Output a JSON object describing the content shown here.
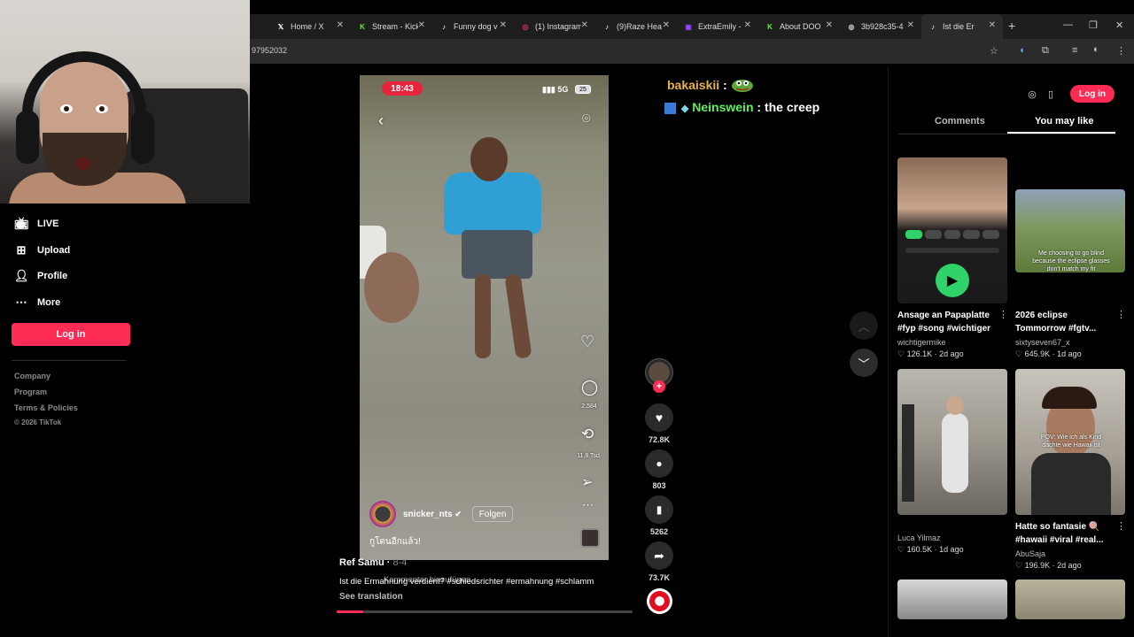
{
  "browser": {
    "tabs": [
      {
        "label": "Home / X",
        "icon": "x-logo-icon",
        "color": "#ffffff"
      },
      {
        "label": "Stream - Kick",
        "icon": "kick-logo-icon",
        "color": "#53fc18"
      },
      {
        "label": "Funny dog v",
        "icon": "tiktok-logo-icon",
        "color": "#ffffff"
      },
      {
        "label": "(1) Instagram",
        "icon": "instagram-logo-icon",
        "color": "#e1306c"
      },
      {
        "label": "(9)Raze Hea",
        "icon": "tiktok-logo-icon",
        "color": "#ffffff"
      },
      {
        "label": "ExtraEmily -",
        "icon": "twitch-logo-icon",
        "color": "#9146ff"
      },
      {
        "label": "About DOO",
        "icon": "kick-logo-icon",
        "color": "#53fc18"
      },
      {
        "label": "3b928c35-4",
        "icon": "globe-icon",
        "color": "#bbbbbb"
      },
      {
        "label": "Ist die Er",
        "icon": "tiktok-logo-icon",
        "color": "#ffffff",
        "active": true
      }
    ],
    "url_fragment": "97952032",
    "new_tab": "+"
  },
  "left_nav": {
    "items": [
      {
        "label": "LIVE",
        "icon": "live-tv-icon"
      },
      {
        "label": "Upload",
        "icon": "plus-square-icon"
      },
      {
        "label": "Profile",
        "icon": "person-icon"
      },
      {
        "label": "More",
        "icon": "more-dots-icon"
      }
    ],
    "login_label": "Log in",
    "footer": [
      "Company",
      "Program",
      "Terms & Policies",
      "© 2026 TikTok"
    ]
  },
  "video": {
    "status_time": "18:43",
    "status_net": "5G",
    "status_battery": "25",
    "inner_counts": {
      "comments": "2.584",
      "shares": "11,8 Tsd."
    },
    "inner_user": "snicker_nts",
    "inner_follow": "Folgen",
    "inner_caption": "กูโดนอีกแล้ว!",
    "author": "Ref Samu",
    "date": "8-4",
    "description": "Ist die Ermahnung verdient? #schiedsrichter #ermahnung #schlamm",
    "overlay_text": "Kommentar hinzufügen...",
    "see_translation": "See translation",
    "progress": 0.09
  },
  "actions": {
    "likes": "72.8K",
    "comments": "803",
    "saves": "5262",
    "shares": "73.7K"
  },
  "chat": [
    {
      "user": "bakaiskii",
      "user_color": "#e8b24a",
      "message": ""
    },
    {
      "user": "Neinswein",
      "user_color": "#5ef05e",
      "message": "the creep"
    }
  ],
  "right_panel": {
    "login_label": "Log in",
    "tabs": [
      "Comments",
      "You may like"
    ],
    "cards": [
      {
        "title": "Ansage an Papaplatte #fyp #song #wichtiger",
        "user": "wichtigermike",
        "likes": "126.1K",
        "age": "2d ago"
      },
      {
        "title": "2026 eclipse Tommorrow #fgtv...",
        "user": "sixtyseven67_x",
        "likes": "645.9K",
        "age": "1d ago",
        "caption": "Me choosing to go blind because the eclipse glasses don't match my fit"
      },
      {
        "title": "",
        "user": "Luca Yilmaz",
        "likes": "160.5K",
        "age": "1d ago"
      },
      {
        "title": "Hatte so fantasie 🍭 #hawaii #viral #real...",
        "user": "AbuSaja",
        "likes": "196.9K",
        "age": "2d ago",
        "caption": "POV: Wie ich als Kind dachte wie Hawaii ist"
      }
    ]
  },
  "colors": {
    "accent": "#fe2c55",
    "background": "#000000"
  }
}
